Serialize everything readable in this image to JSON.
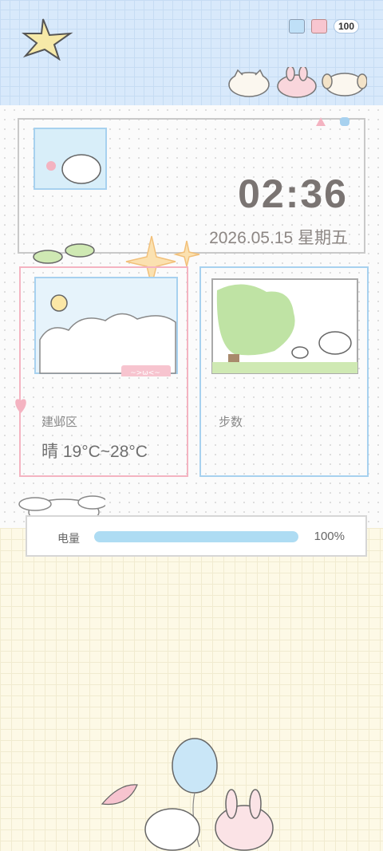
{
  "status_bar": {
    "battery": "100",
    "icons": [
      "calendar-icon",
      "calendar-heart-icon",
      "battery-icon"
    ]
  },
  "clock": {
    "time": "02:36",
    "date": "2026.05.15 星期五"
  },
  "weather_card": {
    "district": "建邺区",
    "condition_temp": "晴  19°C~28°C",
    "tag_text": "~>ω<~"
  },
  "steps_card": {
    "label": "步数"
  },
  "battery_widget": {
    "label": "电量",
    "value": "100%",
    "level_percent": 100
  },
  "colors": {
    "accent_blue": "#aedcf3",
    "accent_pink": "#f4b3c1",
    "text": "#6b6b6b"
  }
}
